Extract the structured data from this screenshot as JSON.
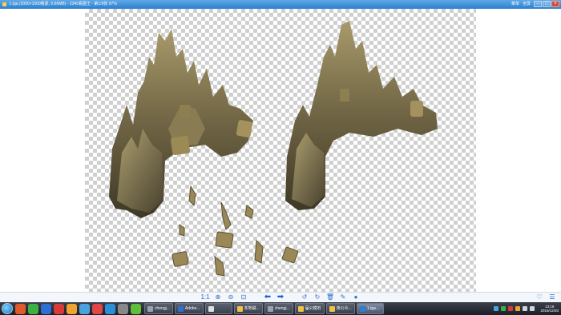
{
  "window": {
    "title": "1.tga (2000×1500像素, 0.60MB) - 2345看图王 - 第1/9张 97%",
    "controls": [
      "菜单",
      "全屏"
    ],
    "colors": {
      "titlebar": "#2b7fd0",
      "canvas_check": "#cfcfcf"
    }
  },
  "toolbar": {
    "buttons": [
      {
        "name": "actual-size-button",
        "icon": "1:1"
      },
      {
        "name": "zoom-in-button",
        "icon": "⊕"
      },
      {
        "name": "zoom-out-button",
        "icon": "⊖"
      },
      {
        "name": "fit-button",
        "icon": "⊡"
      },
      {
        "name": "prev-button",
        "icon": "⬅"
      },
      {
        "name": "next-button",
        "icon": "➡"
      },
      {
        "name": "rotate-left-button",
        "icon": "↺"
      },
      {
        "name": "rotate-right-button",
        "icon": "↻"
      },
      {
        "name": "delete-button",
        "icon": "🗑"
      },
      {
        "name": "edit-button",
        "icon": "✎"
      },
      {
        "name": "more-button",
        "icon": "●"
      }
    ],
    "right": [
      {
        "name": "favorite-button",
        "icon": "♡"
      },
      {
        "name": "menu-button",
        "icon": "☰"
      }
    ]
  },
  "taskbar": {
    "quick_icons": [
      "#e05a2b",
      "#3cb043",
      "#2f6fd1",
      "#d83a3a",
      "#f2a22f",
      "#4aa3df",
      "#e04646",
      "#2a8fd6",
      "#888888",
      "#5fbf3a"
    ],
    "tasks": [
      {
        "label": "chengj...",
        "color": "#9aa3b5"
      },
      {
        "label": "Adobe...",
        "color": "#2f6fd1"
      },
      {
        "label": "",
        "color": "#e0e0e0"
      },
      {
        "label": "本地磁...",
        "color": "#f0c24a"
      },
      {
        "label": "chengj...",
        "color": "#9aa3b5"
      },
      {
        "label": "届公模石",
        "color": "#f0c24a"
      },
      {
        "label": "夜公众...",
        "color": "#f0c24a"
      },
      {
        "label": "1.tga...",
        "color": "#2b7fd0",
        "active": true
      }
    ],
    "clock_time": "13:19",
    "clock_date": "2016/12/20"
  }
}
